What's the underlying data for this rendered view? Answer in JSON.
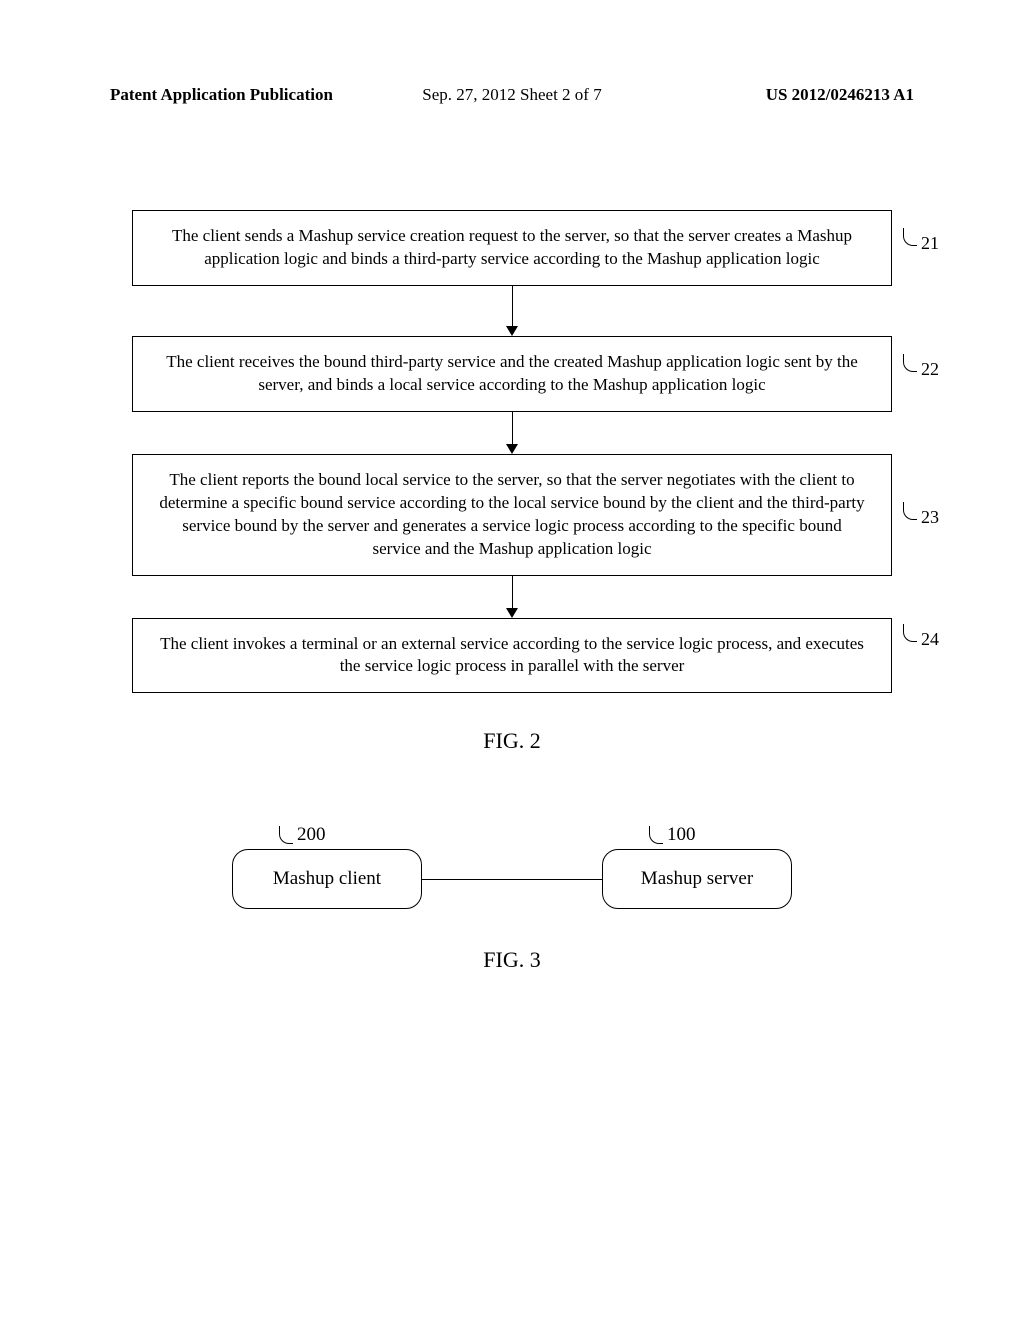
{
  "header": {
    "left": "Patent Application Publication",
    "center": "Sep. 27, 2012  Sheet 2 of 7",
    "right": "US 2012/0246213 A1"
  },
  "flowchart": {
    "boxes": [
      {
        "id": "21",
        "text": "The client sends a Mashup service creation request to the server, so that the server creates a Mashup application logic and binds a third-party service according to the Mashup application logic"
      },
      {
        "id": "22",
        "text": "The client receives the bound third-party service and the created Mashup application logic sent by the server, and binds a local service according to the Mashup application logic"
      },
      {
        "id": "23",
        "text": "The client reports the bound local service to the server, so that the server negotiates with the client to determine a specific bound service according to the local service bound by the client and the third-party service bound by the server and generates a service logic process according to the specific bound service and the Mashup application logic"
      },
      {
        "id": "24",
        "text": "The client invokes a terminal or an external service according to the service logic process, and executes the service logic process in parallel with the server"
      }
    ],
    "caption": "FIG. 2"
  },
  "fig3": {
    "left_box": {
      "label": "200",
      "text": "Mashup client"
    },
    "right_box": {
      "label": "100",
      "text": "Mashup server"
    },
    "caption": "FIG. 3"
  },
  "chart_data": [
    {
      "type": "flowchart",
      "title": "FIG. 2",
      "nodes": [
        {
          "id": "21",
          "text": "The client sends a Mashup service creation request to the server, so that the server creates a Mashup application logic and binds a third-party service according to the Mashup application logic"
        },
        {
          "id": "22",
          "text": "The client receives the bound third-party service and the created Mashup application logic sent by the server, and binds a local service according to the Mashup application logic"
        },
        {
          "id": "23",
          "text": "The client reports the bound local service to the server, so that the server negotiates with the client to determine a specific bound service according to the local service bound by the client and the third-party service bound by the server and generates a service logic process according to the specific bound service and the Mashup application logic"
        },
        {
          "id": "24",
          "text": "The client invokes a terminal or an external service according to the service logic process, and executes the service logic process in parallel with the server"
        }
      ],
      "edges": [
        {
          "from": "21",
          "to": "22"
        },
        {
          "from": "22",
          "to": "23"
        },
        {
          "from": "23",
          "to": "24"
        }
      ]
    },
    {
      "type": "block-diagram",
      "title": "FIG. 3",
      "nodes": [
        {
          "id": "200",
          "text": "Mashup client"
        },
        {
          "id": "100",
          "text": "Mashup server"
        }
      ],
      "edges": [
        {
          "from": "200",
          "to": "100",
          "style": "line"
        }
      ]
    }
  ]
}
